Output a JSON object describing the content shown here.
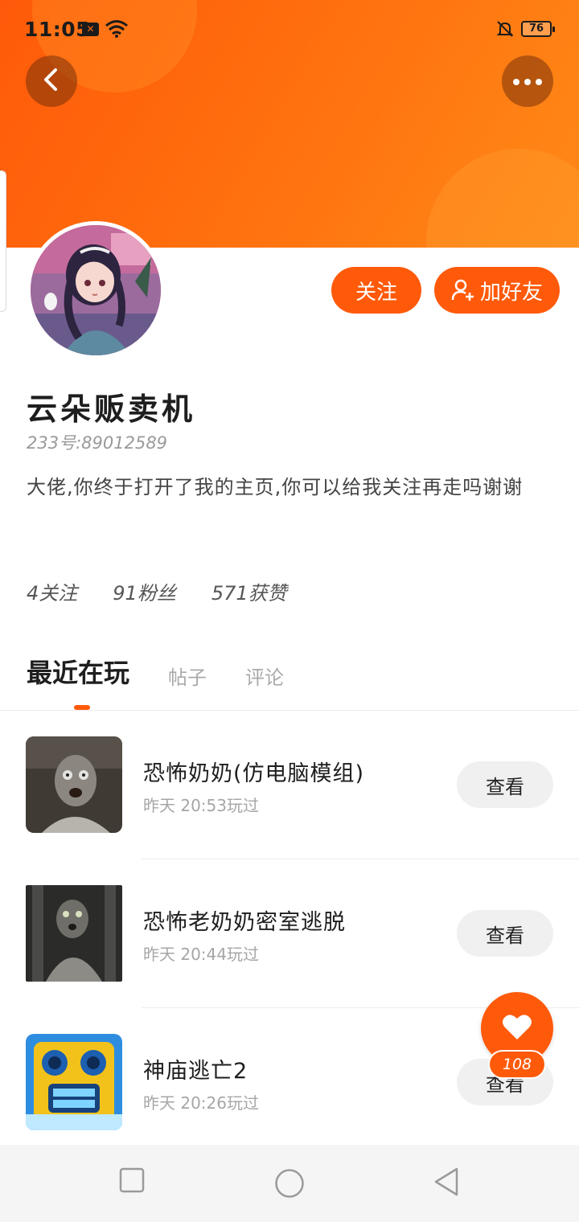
{
  "status_bar": {
    "time": "11:05",
    "battery": "76"
  },
  "profile": {
    "username": "云朵贩卖机",
    "uid": "233号:89012589",
    "bio": "大佬,你终于打开了我的主页,你可以给我关注再走吗谢谢",
    "follow_label": "关注",
    "add_friend_label": "加好友"
  },
  "stats": {
    "following": "4关注",
    "fans": "91粉丝",
    "likes": "571获赞"
  },
  "tabs": [
    {
      "label": "最近在玩",
      "active": true
    },
    {
      "label": "帖子",
      "active": false
    },
    {
      "label": "评论",
      "active": false
    }
  ],
  "games": [
    {
      "name": "恐怖奶奶(仿电脑模组)",
      "time": "昨天 20:53玩过",
      "button": "查看"
    },
    {
      "name": "恐怖老奶奶密室逃脱",
      "time": "昨天 20:44玩过",
      "button": "查看"
    },
    {
      "name": "神庙逃亡2",
      "time": "昨天 20:26玩过",
      "button": "查看"
    }
  ],
  "like_fab": {
    "count": "108"
  },
  "colors": {
    "accent": "#ff5a0a",
    "header_gradient_end": "#ff8a17"
  },
  "icons": [
    "back-arrow-icon",
    "more-icon",
    "add-user-icon",
    "heart-icon",
    "nav-square-icon",
    "nav-circle-icon",
    "nav-triangle-icon"
  ]
}
